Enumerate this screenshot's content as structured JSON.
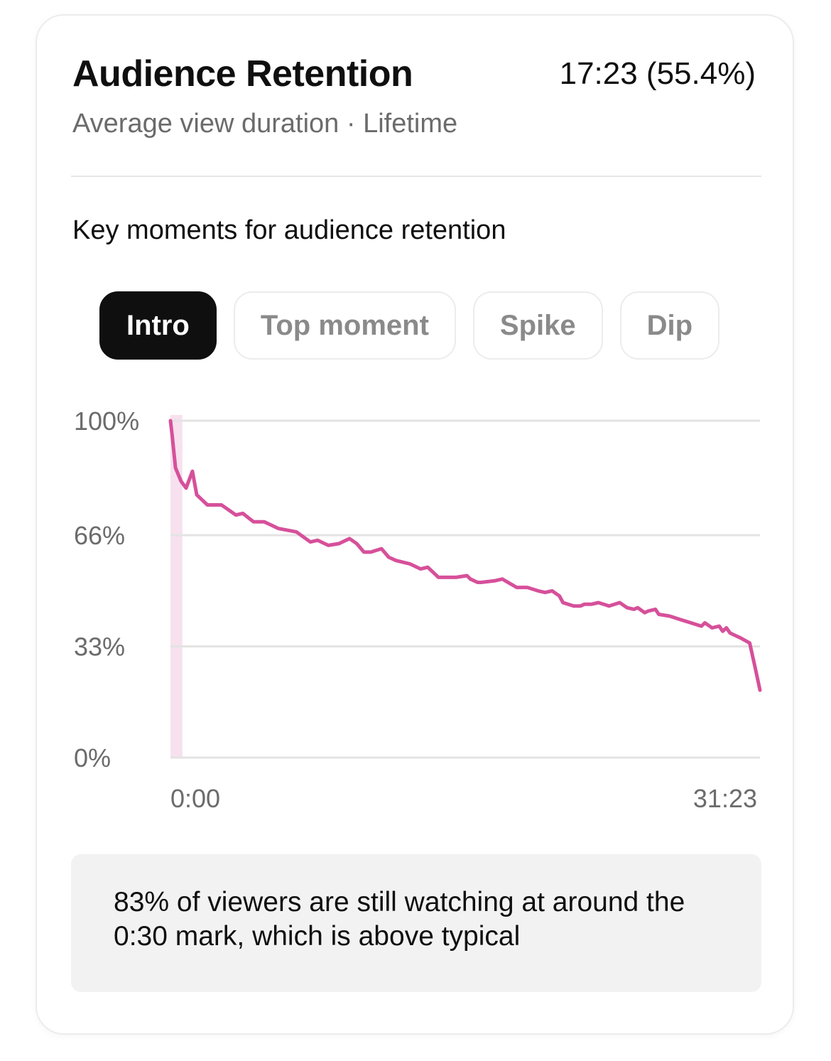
{
  "card": {
    "title": "Audience Retention",
    "headline_value": "17:23 (55.4%)",
    "subtitle": "Average view duration · Lifetime",
    "section_label": "Key moments for audience retention",
    "chips": [
      {
        "label": "Intro",
        "active": true
      },
      {
        "label": "Top moment",
        "active": false
      },
      {
        "label": "Spike",
        "active": false
      },
      {
        "label": "Dip",
        "active": false
      }
    ],
    "insight": "83% of viewers are still watching at around the 0:30 mark, which is above typical"
  },
  "colors": {
    "line": "#d6509a",
    "highlight": "#f7e1ee",
    "grid": "#e3e3e3",
    "axis_text": "#6b6b6b"
  },
  "chart_data": {
    "type": "line",
    "title": "",
    "xlabel": "",
    "ylabel": "",
    "xlim": [
      0,
      1883
    ],
    "ylim": [
      0,
      100
    ],
    "x_tick_labels": [
      "0:00",
      "31:23"
    ],
    "y_ticks": [
      {
        "value": 100,
        "label": "100%"
      },
      {
        "value": 66,
        "label": "66%"
      },
      {
        "value": 33,
        "label": "33%"
      },
      {
        "value": 0,
        "label": "0%"
      }
    ],
    "highlight_range_seconds": [
      0,
      38
    ],
    "grid": true,
    "series": [
      {
        "values_x_seconds": [
          0,
          5,
          16,
          34,
          50,
          70,
          84,
          118,
          163,
          209,
          231,
          265,
          299,
          322,
          345,
          402,
          447,
          470,
          504,
          538,
          572,
          595,
          618,
          640,
          674,
          697,
          720,
          742,
          765,
          799,
          822,
          856,
          879,
          913,
          947,
          958,
          981,
          992,
          1038,
          1060,
          1106,
          1140,
          1174,
          1197,
          1219,
          1242,
          1254,
          1288,
          1310,
          1322,
          1344,
          1367,
          1401,
          1435,
          1458,
          1481,
          1492,
          1515,
          1526,
          1549,
          1560,
          1594,
          1628,
          1662,
          1696,
          1707,
          1730,
          1753,
          1764,
          1776,
          1787,
          1798,
          1821,
          1850,
          1867,
          1883
        ],
        "values_y_percent": [
          100,
          96,
          86,
          82,
          80,
          85,
          78,
          75,
          75,
          72,
          72.5,
          70,
          70,
          69,
          68,
          67,
          64,
          64.5,
          63,
          63.5,
          65,
          63.5,
          61,
          61,
          62,
          59.5,
          58.5,
          58,
          57.5,
          56,
          56.5,
          53.5,
          53.5,
          53.5,
          54,
          53,
          52,
          52,
          52.5,
          53,
          50.5,
          50.5,
          49.5,
          49,
          49.5,
          48,
          46,
          45,
          45,
          45.5,
          45.5,
          46,
          45,
          46,
          44.5,
          44,
          44.5,
          43,
          43.5,
          44,
          42.5,
          42,
          41,
          40,
          39,
          40,
          38.5,
          39,
          37.5,
          38.5,
          37,
          36.5,
          35.5,
          34,
          27,
          20
        ]
      }
    ]
  }
}
